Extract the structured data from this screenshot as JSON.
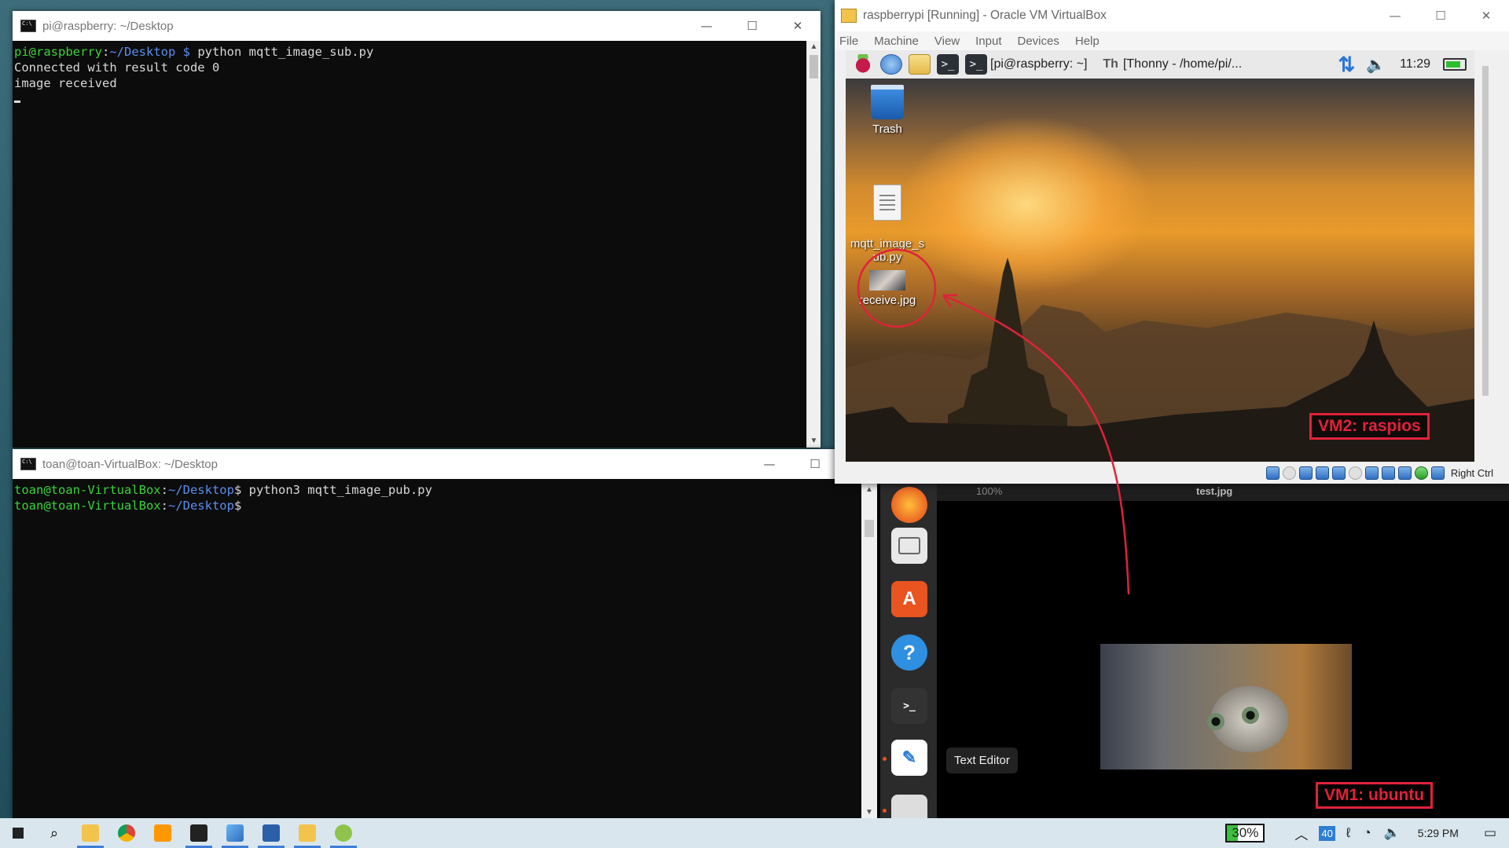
{
  "terminal_pi": {
    "title": "pi@raspberry: ~/Desktop",
    "prompt_user": "pi@raspberry",
    "prompt_path": "~/Desktop",
    "prompt_sep": " $ ",
    "command": "python mqtt_image_sub.py",
    "output_1": "Connected with result code 0",
    "output_2": "image received"
  },
  "terminal_toan": {
    "title": "toan@toan-VirtualBox: ~/Desktop",
    "prompt_user": "toan@toan-VirtualBox",
    "prompt_path": "~/Desktop",
    "prompt_sep": "$ ",
    "command": "python3 mqtt_image_pub.py"
  },
  "window_buttons": {
    "minimize": "—",
    "maximize": "☐",
    "close": "✕"
  },
  "virtualbox": {
    "title": "raspberrypi [Running] - Oracle VM VirtualBox",
    "menu": [
      "File",
      "Machine",
      "View",
      "Input",
      "Devices",
      "Help"
    ],
    "status_host_key": "Right Ctrl"
  },
  "raspi_panel": {
    "task_terminal": "[pi@raspberry: ~]",
    "task_thonny": "[Thonny  -  /home/pi/...",
    "clock": "11:29"
  },
  "raspi_desktop": {
    "icons": [
      {
        "label": "Trash",
        "icon": "trash-icon"
      },
      {
        "label": "mqtt_image_s\nub.py",
        "icon": "text-file-icon"
      },
      {
        "label": "receive.jpg",
        "icon": "image-file-icon"
      }
    ]
  },
  "annotations": {
    "vm2": "VM2: raspios",
    "vm1": "VM1: ubuntu",
    "color": "#e0223a"
  },
  "ubuntu": {
    "viewer_title": "test.jpg",
    "zoom": "100%",
    "tooltip": "Text Editor",
    "dock": [
      "firefox-icon",
      "files-icon",
      "software-icon",
      "help-icon",
      "terminal-icon",
      "text-editor-icon",
      "screenshot-icon"
    ]
  },
  "taskbar": {
    "battery": "30%",
    "badge": "40",
    "clock": "5:29 PM"
  }
}
